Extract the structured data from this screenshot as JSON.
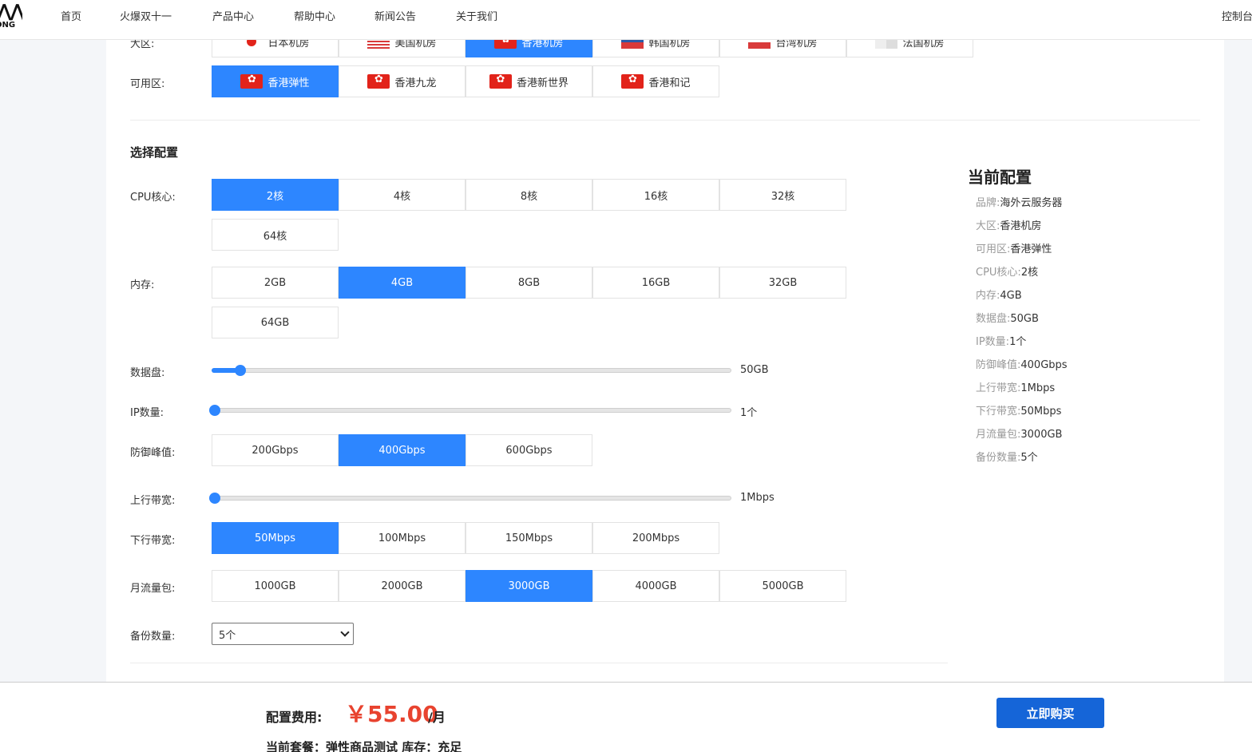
{
  "nav": {
    "logo_text": "ONG",
    "items": [
      {
        "label": "首页"
      },
      {
        "label": "火爆双十一"
      },
      {
        "label": "产品中心"
      },
      {
        "label": "帮助中心"
      },
      {
        "label": "新闻公告"
      },
      {
        "label": "关于我们"
      }
    ],
    "console": "控制台"
  },
  "region": {
    "label": "大区:",
    "options": [
      {
        "label": "日本机房",
        "flag": "jp",
        "active": false
      },
      {
        "label": "美国机房",
        "flag": "us",
        "active": false
      },
      {
        "label": "香港机房",
        "flag": "hk",
        "active": true
      },
      {
        "label": "韩国机房",
        "flag": "kr",
        "active": false
      },
      {
        "label": "台湾机房",
        "flag": "tw",
        "active": false
      },
      {
        "label": "法国机房",
        "flag": "fr",
        "active": false
      }
    ]
  },
  "zone": {
    "label": "可用区:",
    "options": [
      {
        "label": "香港弹性",
        "active": true
      },
      {
        "label": "香港九龙",
        "active": false
      },
      {
        "label": "香港新世界",
        "active": false
      },
      {
        "label": "香港和记",
        "active": false
      }
    ]
  },
  "config": {
    "title": "选择配置",
    "cpu": {
      "label": "CPU核心:",
      "options": [
        "2核",
        "4核",
        "8核",
        "16核",
        "32核",
        "64核"
      ],
      "selected": 0
    },
    "memory": {
      "label": "内存:",
      "options": [
        "2GB",
        "4GB",
        "8GB",
        "16GB",
        "32GB",
        "64GB"
      ],
      "selected": 1
    },
    "disk": {
      "label": "数据盘:",
      "value": "50GB",
      "fraction": 0.05
    },
    "ip": {
      "label": "IP数量:",
      "value": "1个",
      "fraction": 0.0
    },
    "ddos": {
      "label": "防御峰值:",
      "options": [
        "200Gbps",
        "400Gbps",
        "600Gbps"
      ],
      "selected": 1
    },
    "upload": {
      "label": "上行带宽:",
      "value": "1Mbps",
      "fraction": 0.0
    },
    "download": {
      "label": "下行带宽:",
      "options": [
        "50Mbps",
        "100Mbps",
        "150Mbps",
        "200Mbps"
      ],
      "selected": 0
    },
    "traffic": {
      "label": "月流量包:",
      "options": [
        "1000GB",
        "2000GB",
        "3000GB",
        "4000GB",
        "5000GB"
      ],
      "selected": 2
    },
    "backup": {
      "label": "备份数量:",
      "value": "5个"
    }
  },
  "summary": {
    "title": "当前配置",
    "rows": [
      {
        "k": "品牌:",
        "v": "海外云服务器"
      },
      {
        "k": "大区:",
        "v": "香港机房"
      },
      {
        "k": "可用区:",
        "v": "香港弹性"
      },
      {
        "k": "CPU核心:",
        "v": "2核"
      },
      {
        "k": "内存:",
        "v": "4GB"
      },
      {
        "k": "数据盘:",
        "v": "50GB"
      },
      {
        "k": "IP数量:",
        "v": "1个"
      },
      {
        "k": "防御峰值:",
        "v": "400Gbps"
      },
      {
        "k": "上行带宽:",
        "v": "1Mbps"
      },
      {
        "k": "下行带宽:",
        "v": "50Mbps"
      },
      {
        "k": "月流量包:",
        "v": "3000GB"
      },
      {
        "k": "备份数量:",
        "v": "5个"
      }
    ]
  },
  "footer": {
    "fee_label": "配置费用:",
    "price": "￥55.00",
    "unit": "/月",
    "plan_info": "当前套餐：弹性商品测试 库存：充足",
    "buy_button": "立即购买"
  },
  "colors": {
    "accent": "#2d86ff",
    "price": "#e8432f",
    "buy": "#1565d8"
  }
}
